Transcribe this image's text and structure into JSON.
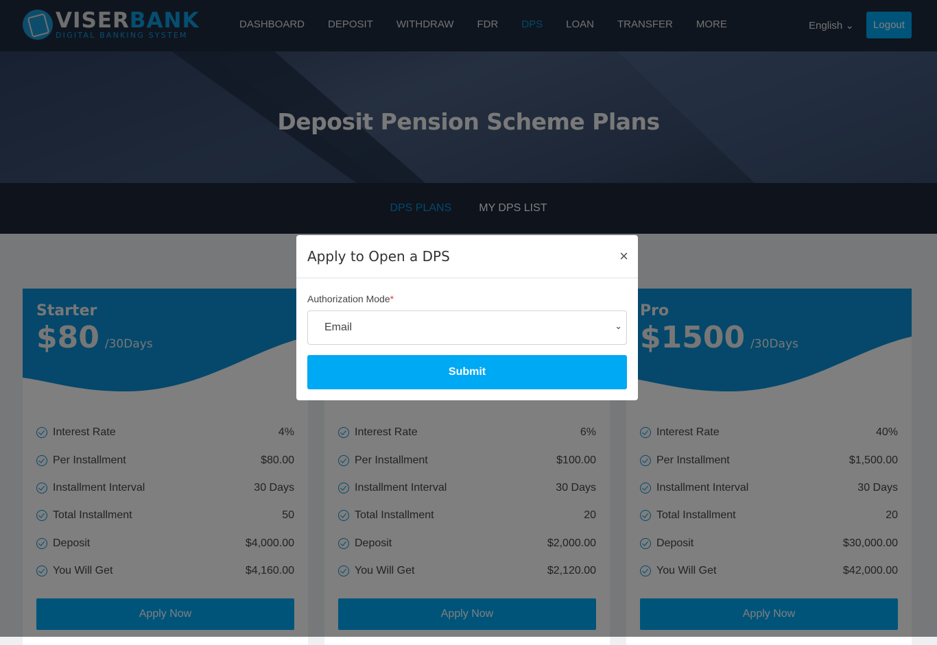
{
  "brand": {
    "name_a": "VISER",
    "name_b": "BANK",
    "tagline": "DIGITAL BANKING SYSTEM"
  },
  "nav": [
    {
      "label": "DASHBOARD"
    },
    {
      "label": "DEPOSIT"
    },
    {
      "label": "WITHDRAW"
    },
    {
      "label": "FDR"
    },
    {
      "label": "DPS",
      "active": true
    },
    {
      "label": "LOAN"
    },
    {
      "label": "TRANSFER"
    },
    {
      "label": "MORE"
    }
  ],
  "language": "English",
  "logout": "Logout",
  "hero_title": "Deposit Pension Scheme Plans",
  "tabs": [
    {
      "label": "DPS PLANS",
      "active": true
    },
    {
      "label": "MY DPS LIST"
    }
  ],
  "colors": {
    "accent": "#00a9f4",
    "header": "#1f2a3e"
  },
  "plans": [
    {
      "name": "Starter",
      "price": "$80",
      "per": "/30Days",
      "rows": [
        [
          "Interest Rate",
          "4%"
        ],
        [
          "Per Installment",
          "$80.00"
        ],
        [
          "Installment Interval",
          "30 Days"
        ],
        [
          "Total Installment",
          "50"
        ],
        [
          "Deposit",
          "$4,000.00"
        ],
        [
          "You Will Get",
          "$4,160.00"
        ]
      ],
      "button": "Apply Now"
    },
    {
      "name": "",
      "price": "",
      "per": "",
      "rows": [
        [
          "Interest Rate",
          "6%"
        ],
        [
          "Per Installment",
          "$100.00"
        ],
        [
          "Installment Interval",
          "30 Days"
        ],
        [
          "Total Installment",
          "20"
        ],
        [
          "Deposit",
          "$2,000.00"
        ],
        [
          "You Will Get",
          "$2,120.00"
        ]
      ],
      "button": "Apply Now"
    },
    {
      "name": "Pro",
      "price": "$1500",
      "per": "/30Days",
      "rows": [
        [
          "Interest Rate",
          "40%"
        ],
        [
          "Per Installment",
          "$1,500.00"
        ],
        [
          "Installment Interval",
          "30 Days"
        ],
        [
          "Total Installment",
          "20"
        ],
        [
          "Deposit",
          "$30,000.00"
        ],
        [
          "You Will Get",
          "$42,000.00"
        ]
      ],
      "button": "Apply Now"
    }
  ],
  "modal": {
    "title": "Apply to Open a DPS",
    "close": "×",
    "field_label": "Authorization Mode",
    "required": "*",
    "selected": "Email",
    "submit": "Submit"
  }
}
